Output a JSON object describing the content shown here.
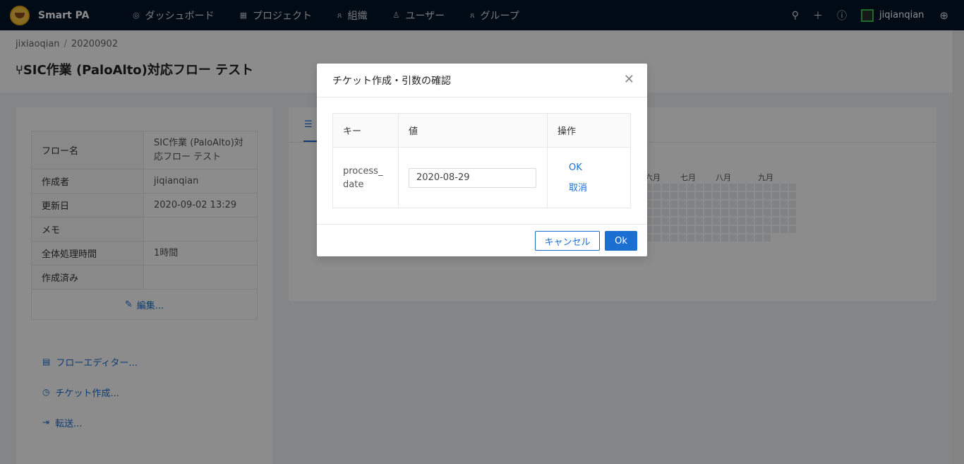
{
  "app": {
    "title": "Smart PA"
  },
  "nav": [
    {
      "label": "ダッシュボード",
      "icon": "dashboard-icon"
    },
    {
      "label": "プロジェクト",
      "icon": "project-icon"
    },
    {
      "label": "組織",
      "icon": "org-icon"
    },
    {
      "label": "ユーザー",
      "icon": "user-icon"
    },
    {
      "label": "グループ",
      "icon": "group-icon"
    }
  ],
  "user": {
    "name": "jiqianqian"
  },
  "breadcrumb": [
    "jixiaoqian",
    "20200902"
  ],
  "page": {
    "title": "SIC作業 (PaloAlto)対応フロー テスト"
  },
  "info": {
    "rows": [
      {
        "key": "フロー名",
        "value": "SIC作業 (PaloAlto)対応フロー テスト"
      },
      {
        "key": "作成者",
        "value": "jiqianqian"
      },
      {
        "key": "更新日",
        "value": "2020-09-02 13:29"
      },
      {
        "key": "メモ",
        "value": ""
      },
      {
        "key": "全体処理時間",
        "value": "1時間"
      },
      {
        "key": "作成済み",
        "value": ""
      }
    ],
    "edit_label": "編集..."
  },
  "actions": [
    {
      "label": "フローエディター...",
      "icon": "flow-editor-icon"
    },
    {
      "label": "チケット作成...",
      "icon": "ticket-icon"
    },
    {
      "label": "転送...",
      "icon": "transfer-icon"
    }
  ],
  "heatmap": {
    "months": [
      "六月",
      "七月",
      "八月",
      "九月"
    ]
  },
  "modal": {
    "title": "チケット作成・引数の確認",
    "columns": {
      "key": "キー",
      "value": "値",
      "ops": "操作"
    },
    "row": {
      "key": "process_date",
      "value": "2020-08-29",
      "ok": "OK",
      "cancel": "取消"
    },
    "cancel_button": "キャンセル",
    "ok_button": "Ok"
  }
}
